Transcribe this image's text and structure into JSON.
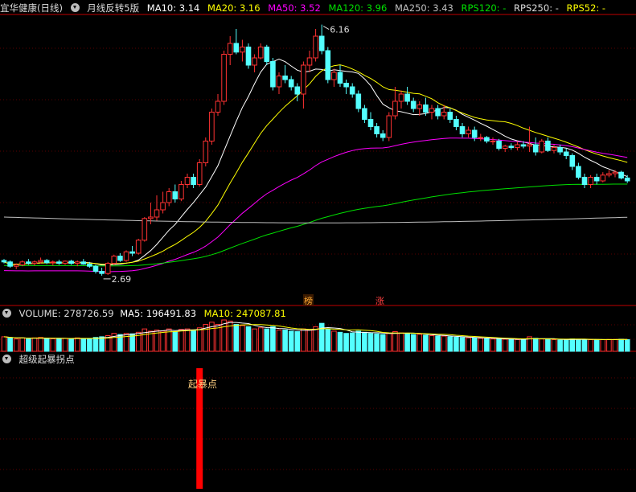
{
  "header": {
    "stock_name": "宜华健康(日线)",
    "indicator_name": "月线反转5版",
    "ma10": "MA10: 3.14",
    "ma20": "MA20: 3.16",
    "ma50": "MA50: 3.52",
    "ma120": "MA120: 3.96",
    "ma250": "MA250: 3.43",
    "rps120": "RPS120: -",
    "rps250": "RPS250: -",
    "rps52": "RPS52: -"
  },
  "price_annotations": {
    "high": "6.16",
    "low": "2.69",
    "marker_1": "榜",
    "marker_2": "涨"
  },
  "volume_header": {
    "volume": "VOLUME: 278726.59",
    "ma5": "MA5: 196491.83",
    "ma10": "MA10: 247087.81"
  },
  "signal_panel": {
    "title": "超级起暴拐点",
    "signal_label": "起暴点"
  },
  "colors": {
    "up": "#ff3232",
    "down": "#54ffff",
    "ma10": "#ffffff",
    "ma20": "#ffff00",
    "ma50": "#ff00ff",
    "ma120": "#00e000",
    "ma250": "#c0c0c0",
    "signal": "#ff0000"
  },
  "chart_data": {
    "type": "candlestick",
    "ylim": [
      2.5,
      6.3
    ],
    "candles": [
      [
        2.9,
        2.92,
        2.86,
        2.88
      ],
      [
        2.88,
        2.9,
        2.8,
        2.82
      ],
      [
        2.82,
        2.86,
        2.78,
        2.84
      ],
      [
        2.84,
        2.9,
        2.82,
        2.88
      ],
      [
        2.88,
        2.92,
        2.84,
        2.86
      ],
      [
        2.86,
        2.9,
        2.83,
        2.88
      ],
      [
        2.88,
        2.94,
        2.86,
        2.9
      ],
      [
        2.9,
        2.92,
        2.85,
        2.87
      ],
      [
        2.87,
        2.9,
        2.83,
        2.88
      ],
      [
        2.88,
        2.91,
        2.84,
        2.86
      ],
      [
        2.86,
        2.9,
        2.84,
        2.89
      ],
      [
        2.89,
        2.91,
        2.84,
        2.86
      ],
      [
        2.86,
        2.9,
        2.82,
        2.88
      ],
      [
        2.88,
        2.92,
        2.84,
        2.85
      ],
      [
        2.85,
        2.88,
        2.8,
        2.82
      ],
      [
        2.82,
        2.84,
        2.72,
        2.75
      ],
      [
        2.75,
        2.8,
        2.69,
        2.72
      ],
      [
        2.72,
        2.88,
        2.7,
        2.86
      ],
      [
        2.86,
        2.98,
        2.84,
        2.96
      ],
      [
        2.96,
        3.0,
        2.88,
        2.9
      ],
      [
        2.9,
        3.04,
        2.88,
        3.02
      ],
      [
        3.02,
        3.1,
        2.96,
        3.0
      ],
      [
        3.0,
        3.2,
        2.98,
        3.18
      ],
      [
        3.18,
        3.5,
        3.16,
        3.48
      ],
      [
        3.48,
        3.7,
        3.4,
        3.5
      ],
      [
        3.5,
        3.8,
        3.45,
        3.6
      ],
      [
        3.6,
        3.85,
        3.55,
        3.7
      ],
      [
        3.7,
        3.9,
        3.65,
        3.85
      ],
      [
        3.85,
        3.95,
        3.7,
        3.75
      ],
      [
        3.75,
        4.0,
        3.72,
        3.95
      ],
      [
        3.95,
        4.1,
        3.9,
        4.05
      ],
      [
        4.05,
        4.1,
        3.9,
        3.95
      ],
      [
        3.95,
        4.3,
        3.92,
        4.25
      ],
      [
        4.25,
        4.6,
        4.2,
        4.55
      ],
      [
        4.55,
        5.0,
        4.5,
        4.95
      ],
      [
        4.95,
        5.2,
        4.9,
        5.1
      ],
      [
        5.1,
        5.8,
        5.05,
        5.75
      ],
      [
        5.75,
        6.0,
        5.6,
        5.9
      ],
      [
        5.9,
        6.1,
        5.75,
        5.78
      ],
      [
        5.78,
        5.95,
        5.65,
        5.85
      ],
      [
        5.85,
        5.9,
        5.55,
        5.6
      ],
      [
        5.6,
        5.75,
        5.5,
        5.7
      ],
      [
        5.7,
        5.9,
        5.68,
        5.85
      ],
      [
        5.85,
        5.88,
        5.6,
        5.65
      ],
      [
        5.65,
        5.7,
        5.25,
        5.3
      ],
      [
        5.3,
        5.5,
        5.2,
        5.45
      ],
      [
        5.45,
        5.6,
        5.35,
        5.4
      ],
      [
        5.4,
        5.45,
        5.25,
        5.3
      ],
      [
        5.3,
        5.35,
        5.1,
        5.2
      ],
      [
        5.2,
        5.65,
        5.0,
        5.6
      ],
      [
        5.6,
        5.8,
        5.5,
        5.7
      ],
      [
        5.7,
        6.1,
        5.65,
        6.0
      ],
      [
        6.0,
        6.16,
        5.75,
        5.8
      ],
      [
        5.8,
        5.85,
        5.35,
        5.4
      ],
      [
        5.4,
        5.55,
        5.3,
        5.5
      ],
      [
        5.5,
        5.6,
        5.3,
        5.35
      ],
      [
        5.35,
        5.4,
        5.2,
        5.3
      ],
      [
        5.3,
        5.35,
        5.15,
        5.2
      ],
      [
        5.2,
        5.25,
        4.95,
        5.0
      ],
      [
        5.0,
        5.05,
        4.8,
        4.85
      ],
      [
        4.85,
        4.95,
        4.7,
        4.75
      ],
      [
        4.75,
        4.8,
        4.6,
        4.65
      ],
      [
        4.65,
        4.7,
        4.55,
        4.6
      ],
      [
        4.6,
        4.95,
        4.55,
        4.9
      ],
      [
        4.9,
        5.3,
        4.85,
        5.1
      ],
      [
        5.1,
        5.25,
        5.0,
        5.2
      ],
      [
        5.2,
        5.3,
        5.05,
        5.1
      ],
      [
        5.1,
        5.15,
        4.95,
        5.0
      ],
      [
        5.0,
        5.1,
        4.9,
        5.05
      ],
      [
        5.05,
        5.15,
        4.9,
        4.95
      ],
      [
        4.95,
        5.05,
        4.85,
        5.0
      ],
      [
        5.0,
        5.05,
        4.85,
        4.9
      ],
      [
        4.9,
        5.05,
        4.85,
        4.95
      ],
      [
        4.95,
        5.0,
        4.8,
        4.85
      ],
      [
        4.85,
        4.9,
        4.7,
        4.75
      ],
      [
        4.75,
        4.8,
        4.6,
        4.65
      ],
      [
        4.65,
        4.75,
        4.6,
        4.7
      ],
      [
        4.7,
        4.75,
        4.55,
        4.6
      ],
      [
        4.6,
        4.65,
        4.55,
        4.6
      ],
      [
        4.6,
        4.62,
        4.52,
        4.55
      ],
      [
        4.55,
        4.6,
        4.5,
        4.55
      ],
      [
        4.55,
        4.58,
        4.42,
        4.45
      ],
      [
        4.45,
        4.5,
        4.4,
        4.48
      ],
      [
        4.48,
        4.52,
        4.43,
        4.46
      ],
      [
        4.46,
        4.55,
        4.42,
        4.5
      ],
      [
        4.5,
        4.55,
        4.45,
        4.48
      ],
      [
        4.48,
        4.75,
        4.4,
        4.5
      ],
      [
        4.5,
        4.6,
        4.35,
        4.4
      ],
      [
        4.4,
        4.58,
        4.38,
        4.55
      ],
      [
        4.55,
        4.6,
        4.4,
        4.42
      ],
      [
        4.42,
        4.5,
        4.38,
        4.46
      ],
      [
        4.46,
        4.5,
        4.36,
        4.4
      ],
      [
        4.4,
        4.45,
        4.3,
        4.35
      ],
      [
        4.35,
        4.38,
        4.15,
        4.2
      ],
      [
        4.2,
        4.25,
        4.02,
        4.05
      ],
      [
        4.05,
        4.1,
        3.9,
        3.95
      ],
      [
        3.95,
        4.08,
        3.9,
        4.05
      ],
      [
        4.05,
        4.1,
        3.95,
        4.0
      ],
      [
        4.0,
        4.12,
        3.98,
        4.08
      ],
      [
        4.08,
        4.15,
        4.05,
        4.1
      ],
      [
        4.1,
        4.15,
        4.05,
        4.12
      ],
      [
        4.12,
        4.14,
        4.02,
        4.04
      ],
      [
        4.04,
        4.08,
        3.97,
        4.0
      ]
    ],
    "volume": [
      [
        6.5,
        0
      ],
      [
        6,
        1
      ],
      [
        5.5,
        0
      ],
      [
        6,
        0
      ],
      [
        5.5,
        1
      ],
      [
        6,
        0
      ],
      [
        6.2,
        0
      ],
      [
        5.8,
        1
      ],
      [
        5.6,
        0
      ],
      [
        5.5,
        1
      ],
      [
        5.8,
        0
      ],
      [
        5.6,
        1
      ],
      [
        6,
        0
      ],
      [
        5.7,
        1
      ],
      [
        5.5,
        1
      ],
      [
        6.2,
        1
      ],
      [
        6.5,
        1
      ],
      [
        7,
        0
      ],
      [
        8,
        0
      ],
      [
        7.5,
        1
      ],
      [
        8,
        0
      ],
      [
        7.8,
        1
      ],
      [
        8.5,
        0
      ],
      [
        10,
        0
      ],
      [
        9,
        0
      ],
      [
        9.5,
        0
      ],
      [
        9,
        0
      ],
      [
        10,
        0
      ],
      [
        8.8,
        1
      ],
      [
        9.8,
        0
      ],
      [
        10,
        0
      ],
      [
        9.5,
        1
      ],
      [
        10.5,
        0
      ],
      [
        12,
        0
      ],
      [
        13,
        0
      ],
      [
        12,
        0
      ],
      [
        14,
        0
      ],
      [
        13.5,
        0
      ],
      [
        12,
        1
      ],
      [
        11.5,
        0
      ],
      [
        11,
        1
      ],
      [
        10,
        0
      ],
      [
        10.5,
        0
      ],
      [
        10,
        1
      ],
      [
        11,
        1
      ],
      [
        9.5,
        0
      ],
      [
        9.5,
        1
      ],
      [
        9,
        1
      ],
      [
        8.8,
        1
      ],
      [
        10,
        0
      ],
      [
        9.5,
        0
      ],
      [
        11,
        0
      ],
      [
        12.5,
        1
      ],
      [
        10,
        1
      ],
      [
        9,
        0
      ],
      [
        8.5,
        1
      ],
      [
        8,
        1
      ],
      [
        8.2,
        1
      ],
      [
        9,
        1
      ],
      [
        8.5,
        1
      ],
      [
        8,
        1
      ],
      [
        7.8,
        1
      ],
      [
        7.5,
        1
      ],
      [
        8,
        0
      ],
      [
        8.8,
        0
      ],
      [
        8.2,
        0
      ],
      [
        8,
        1
      ],
      [
        7.5,
        1
      ],
      [
        7.6,
        0
      ],
      [
        7.2,
        1
      ],
      [
        7,
        0
      ],
      [
        6.8,
        1
      ],
      [
        6.8,
        0
      ],
      [
        6.5,
        1
      ],
      [
        6.3,
        1
      ],
      [
        6.2,
        1
      ],
      [
        6,
        0
      ],
      [
        6.1,
        1
      ],
      [
        5.8,
        0
      ],
      [
        5.6,
        1
      ],
      [
        5.5,
        0
      ],
      [
        5.6,
        1
      ],
      [
        5.4,
        0
      ],
      [
        5.3,
        1
      ],
      [
        5.2,
        0
      ],
      [
        5.2,
        1
      ],
      [
        6.5,
        0
      ],
      [
        5.8,
        1
      ],
      [
        5.5,
        0
      ],
      [
        5.3,
        1
      ],
      [
        5.2,
        0
      ],
      [
        5,
        1
      ],
      [
        5.2,
        1
      ],
      [
        5.5,
        1
      ],
      [
        5.4,
        1
      ],
      [
        5.3,
        1
      ],
      [
        5.2,
        0
      ],
      [
        5.1,
        1
      ],
      [
        5.2,
        0
      ],
      [
        5.3,
        0
      ],
      [
        5.3,
        0
      ],
      [
        5.4,
        1
      ],
      [
        5.2,
        1
      ]
    ],
    "signals": [
      32
    ]
  }
}
